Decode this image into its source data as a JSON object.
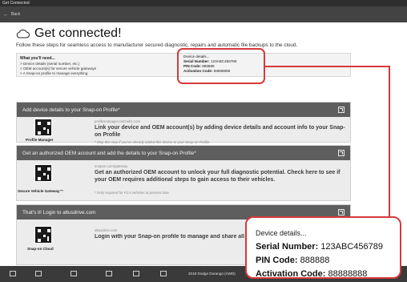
{
  "window": {
    "title": "Get Connected"
  },
  "nav": {
    "back_label": "Back"
  },
  "page": {
    "title": "Get connected!",
    "subtitle": "Follow these steps for seamless access to manufacturer secured diagnostic, repairs and automatic file backups to the cloud."
  },
  "requirements": {
    "title": "What you'll need...",
    "items": [
      "> Device details (serial number, etc.)",
      "> OEM account(s) for secure vehicle gateways",
      "> A Snap-on profile to manage everything"
    ]
  },
  "device": {
    "title": "Device details...",
    "serial_label": "Serial Number:",
    "serial_value": "123ABC456789",
    "pin_label": "PIN Code:",
    "pin_value": "888888",
    "activation_label": "Activation Code:",
    "activation_value": "88888888"
  },
  "cards": [
    {
      "header": "Add device details to your Snap-on Profile*",
      "qr_label": "Profile Manager",
      "url": "profilemanager.mitchell1.com",
      "main": "Link your device and OEM account(s) by adding device details and account info to your Snap-on Profile",
      "note": "* Skip this step if you've already added this device to your Snap-on Profile"
    },
    {
      "header": "Get an authorized OEM account and add the details to your Snap-on Profile*",
      "qr_label": "Secure Vehicle Gateway™",
      "url": "snapon.com/gateway",
      "main": "Get an authorized OEM account to unlock your full diagnostic potential. Check here to see if your OEM requires additional steps to gain access to their vehicles.",
      "note": "* Only required for FCA vehicles at present time"
    },
    {
      "header": "That's it! Login to altusdrive.com",
      "qr_label": "Snap-on Cloud",
      "url": "altusdrive.com",
      "main": "Login with your Snap-on profile to manage and share all your",
      "note": ""
    }
  ],
  "bottom_bar": {
    "vehicle": "2018 Dodge Durango (AWD)"
  }
}
